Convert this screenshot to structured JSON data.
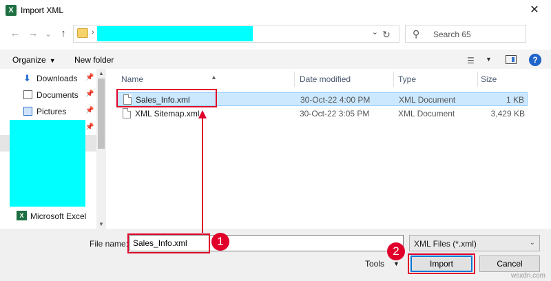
{
  "window": {
    "title": "Import XML",
    "app_icon": "excel-icon",
    "close_glyph": "✕"
  },
  "navigation": {
    "back_glyph": "←",
    "forward_glyph": "→",
    "recent_glyph": "⌄",
    "up_glyph": "↑",
    "refresh_glyph": "↻",
    "search_placeholder": "Search 65"
  },
  "toolbar": {
    "organize_label": "Organize",
    "new_folder_label": "New folder",
    "help_glyph": "?"
  },
  "sidebar": {
    "items": [
      {
        "label": "Downloads",
        "icon": "download-icon"
      },
      {
        "label": "Documents",
        "icon": "document-icon"
      },
      {
        "label": "Pictures",
        "icon": "pictures-icon"
      }
    ],
    "excel_item": {
      "label": "Microsoft Excel",
      "icon": "excel-icon"
    }
  },
  "columns": {
    "name": "Name",
    "date_modified": "Date modified",
    "type": "Type",
    "size": "Size"
  },
  "files": [
    {
      "name": "Sales_Info.xml",
      "date": "30-Oct-22 4:00 PM",
      "type": "XML Document",
      "size": "1 KB",
      "selected": true
    },
    {
      "name": "XML Sitemap.xml",
      "date": "30-Oct-22 3:05 PM",
      "type": "XML Document",
      "size": "3,429 KB",
      "selected": false
    }
  ],
  "bottom": {
    "file_name_label": "File name:",
    "file_name_value": "Sales_Info.xml",
    "filter_value": "XML Files (*.xml)",
    "tools_label": "Tools",
    "import_label": "Import",
    "cancel_label": "Cancel"
  },
  "annotations": {
    "step1": "1",
    "step2": "2",
    "color": "#e0002a"
  },
  "watermark": "wsxdn.com"
}
